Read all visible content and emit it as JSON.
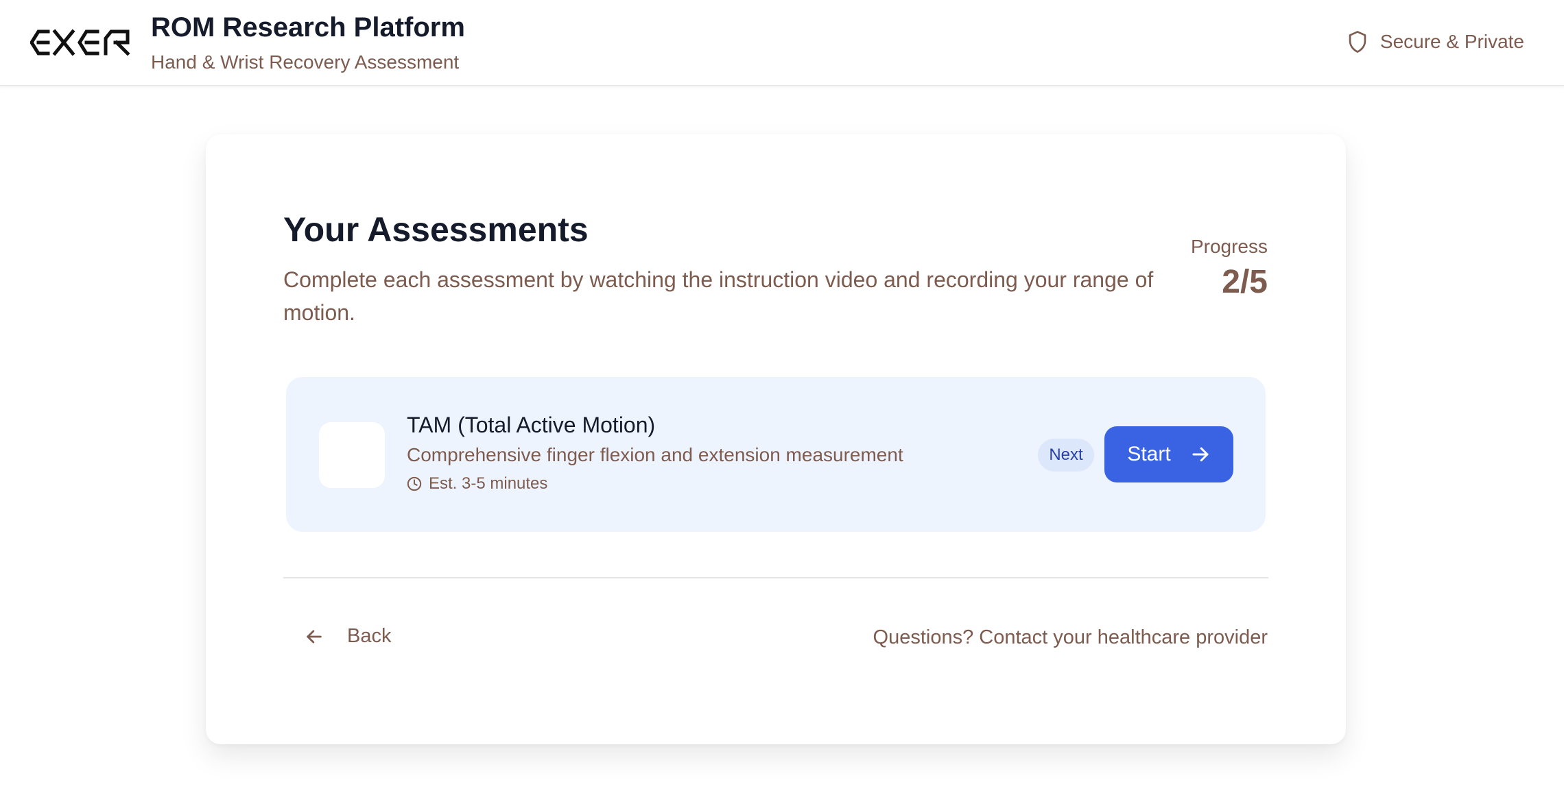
{
  "header": {
    "logo_text": "EXER",
    "title": "ROM Research Platform",
    "subtitle": "Hand & Wrist Recovery Assessment",
    "secure_label": "Secure & Private",
    "secure_icon": "shield-icon"
  },
  "main": {
    "title": "Your Assessments",
    "description": "Complete each assessment by watching the instruction video and recording your range of motion.",
    "progress": {
      "label": "Progress",
      "value": "2/5",
      "completed": 2,
      "total": 5
    },
    "assessments": [
      {
        "title": "TAM (Total Active Motion)",
        "description": "Comprehensive finger flexion and extension measurement",
        "time": "Est. 3-5 minutes",
        "badge": "Next",
        "action_label": "Start"
      }
    ]
  },
  "footer": {
    "back_label": "Back",
    "contact_text": "Questions? Contact your healthcare provider"
  },
  "colors": {
    "primary": "#3a63e4",
    "text_dark": "#151b2b",
    "text_muted": "#7d5b4f",
    "card_highlight": "#eef4fe",
    "badge_bg": "#dde7fb",
    "badge_text": "#2840a8"
  }
}
